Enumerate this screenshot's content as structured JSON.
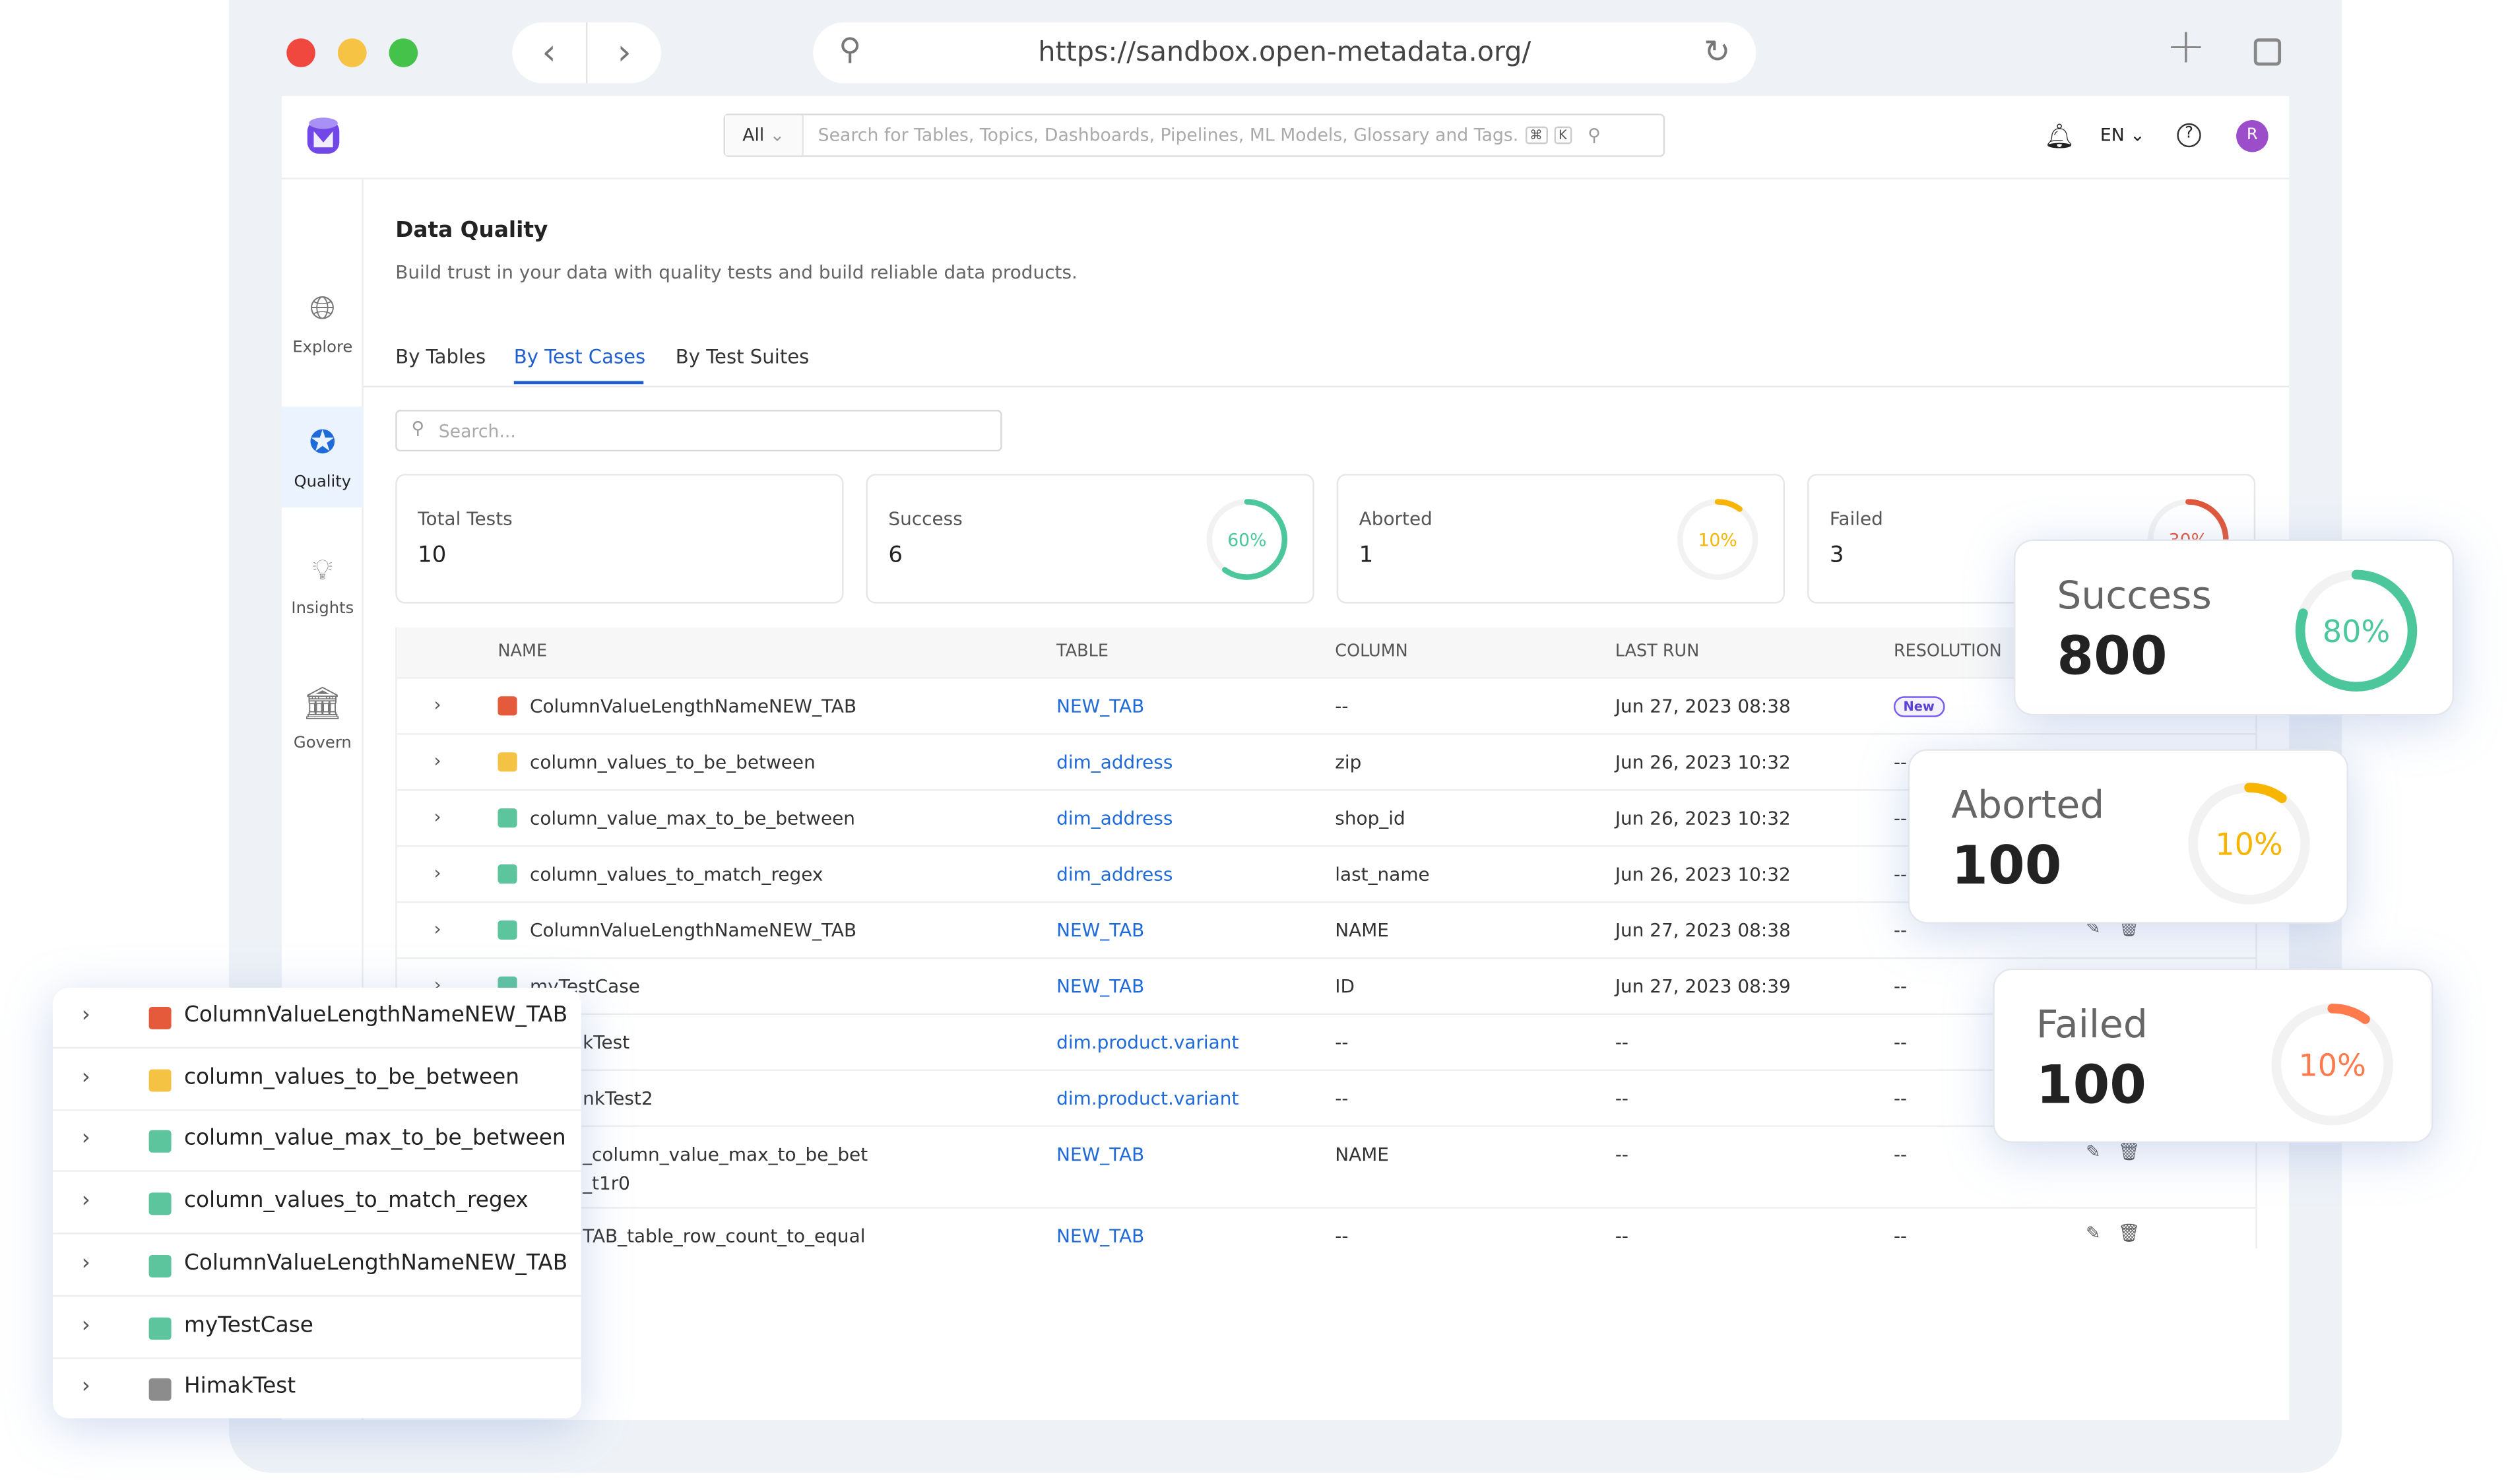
{
  "browser": {
    "url": "https://sandbox.open-metadata.org/",
    "traffic_lights": [
      "#f0473f",
      "#f7c345",
      "#44c24a"
    ]
  },
  "header": {
    "search_scope": "All",
    "search_placeholder": "Search for Tables, Topics, Dashboards, Pipelines, ML Models, Glossary and Tags.",
    "shortcut": [
      "⌘",
      "K"
    ],
    "language": "EN",
    "avatar_letter": "R",
    "avatar_color": "#9b4dca",
    "logo_color": "#7147e8"
  },
  "sidebar": {
    "items": [
      {
        "label": "Explore",
        "icon": "globe-search-icon"
      },
      {
        "label": "Quality",
        "icon": "quality-badge-icon",
        "active": true
      },
      {
        "label": "Insights",
        "icon": "lightbulb-icon"
      },
      {
        "label": "Govern",
        "icon": "bank-icon"
      }
    ]
  },
  "page": {
    "title": "Data Quality",
    "subtitle": "Build trust in your data with quality tests and build reliable data products.",
    "tabs": [
      {
        "label": "By Tables"
      },
      {
        "label": "By Test Cases",
        "active": true
      },
      {
        "label": "By Test Suites"
      }
    ],
    "search_placeholder": "Search..."
  },
  "summary": [
    {
      "label": "Total Tests",
      "value": "10"
    },
    {
      "label": "Success",
      "value": "6",
      "percent": 60,
      "percent_label": "60%",
      "color": "#4cc79b"
    },
    {
      "label": "Aborted",
      "value": "1",
      "percent": 10,
      "percent_label": "10%",
      "color": "#f7b500"
    },
    {
      "label": "Failed",
      "value": "3",
      "percent": 30,
      "percent_label": "30%",
      "color": "#e0583c"
    }
  ],
  "table": {
    "columns": [
      "NAME",
      "TABLE",
      "COLUMN",
      "LAST RUN",
      "RESOLUTION"
    ],
    "rows": [
      {
        "name": "ColumnValueLengthNameNEW_TAB",
        "status": "#e45a3b",
        "table": "NEW_TAB",
        "column": "--",
        "last_run": "Jun 27, 2023 08:38",
        "resolution": "New"
      },
      {
        "name": "column_values_to_be_between",
        "status": "#f5c344",
        "table": "dim_address",
        "column": "zip",
        "last_run": "Jun 26, 2023 10:32",
        "resolution": "--"
      },
      {
        "name": "column_value_max_to_be_between",
        "status": "#5cc59d",
        "table": "dim_address",
        "column": "shop_id",
        "last_run": "Jun 26, 2023 10:32",
        "resolution": "--"
      },
      {
        "name": "column_values_to_match_regex",
        "status": "#5cc59d",
        "table": "dim_address",
        "column": "last_name",
        "last_run": "Jun 26, 2023 10:32",
        "resolution": "--"
      },
      {
        "name": "ColumnValueLengthNameNEW_TAB",
        "status": "#5cc59d",
        "table": "NEW_TAB",
        "column": "NAME",
        "last_run": "Jun 27, 2023 08:38",
        "resolution": "--"
      },
      {
        "name": "myTestCase",
        "status": "#5cc59d",
        "table": "NEW_TAB",
        "column": "ID",
        "last_run": "Jun 27, 2023 08:39",
        "resolution": "--"
      },
      {
        "name": "kTest",
        "table": "dim.product.variant",
        "column": "--",
        "last_run": "--",
        "resolution": "--"
      },
      {
        "name": "nkTest2",
        "table": "dim.product.variant",
        "column": "--",
        "last_run": "--",
        "resolution": "--"
      },
      {
        "name": "_column_value_max_to_be_bet",
        "name_line2": "_t1r0",
        "table": "NEW_TAB",
        "column": "NAME",
        "last_run": "--",
        "resolution": "--"
      },
      {
        "name": "TAB_table_row_count_to_equal",
        "table": "NEW_TAB",
        "column": "--",
        "last_run": "--",
        "resolution": "--"
      }
    ]
  },
  "overlay_cards": [
    {
      "label": "Success",
      "value": "800",
      "percent": 80,
      "percent_label": "80%",
      "color": "#4cc79b"
    },
    {
      "label": "Aborted",
      "value": "100",
      "percent": 10,
      "percent_label": "10%",
      "color": "#f7b500"
    },
    {
      "label": "Failed",
      "value": "100",
      "percent": 10,
      "percent_label": "10%",
      "color": "#ff7a4d"
    }
  ],
  "overlay_list": [
    {
      "name": "ColumnValueLengthNameNEW_TAB",
      "status": "#e45a3b"
    },
    {
      "name": "column_values_to_be_between",
      "status": "#f5c344"
    },
    {
      "name": "column_value_max_to_be_between",
      "status": "#5cc59d"
    },
    {
      "name": "column_values_to_match_regex",
      "status": "#5cc59d"
    },
    {
      "name": "ColumnValueLengthNameNEW_TAB",
      "status": "#5cc59d"
    },
    {
      "name": "myTestCase",
      "status": "#5cc59d"
    },
    {
      "name": "HimakTest",
      "status": "#8c8c8c"
    }
  ]
}
